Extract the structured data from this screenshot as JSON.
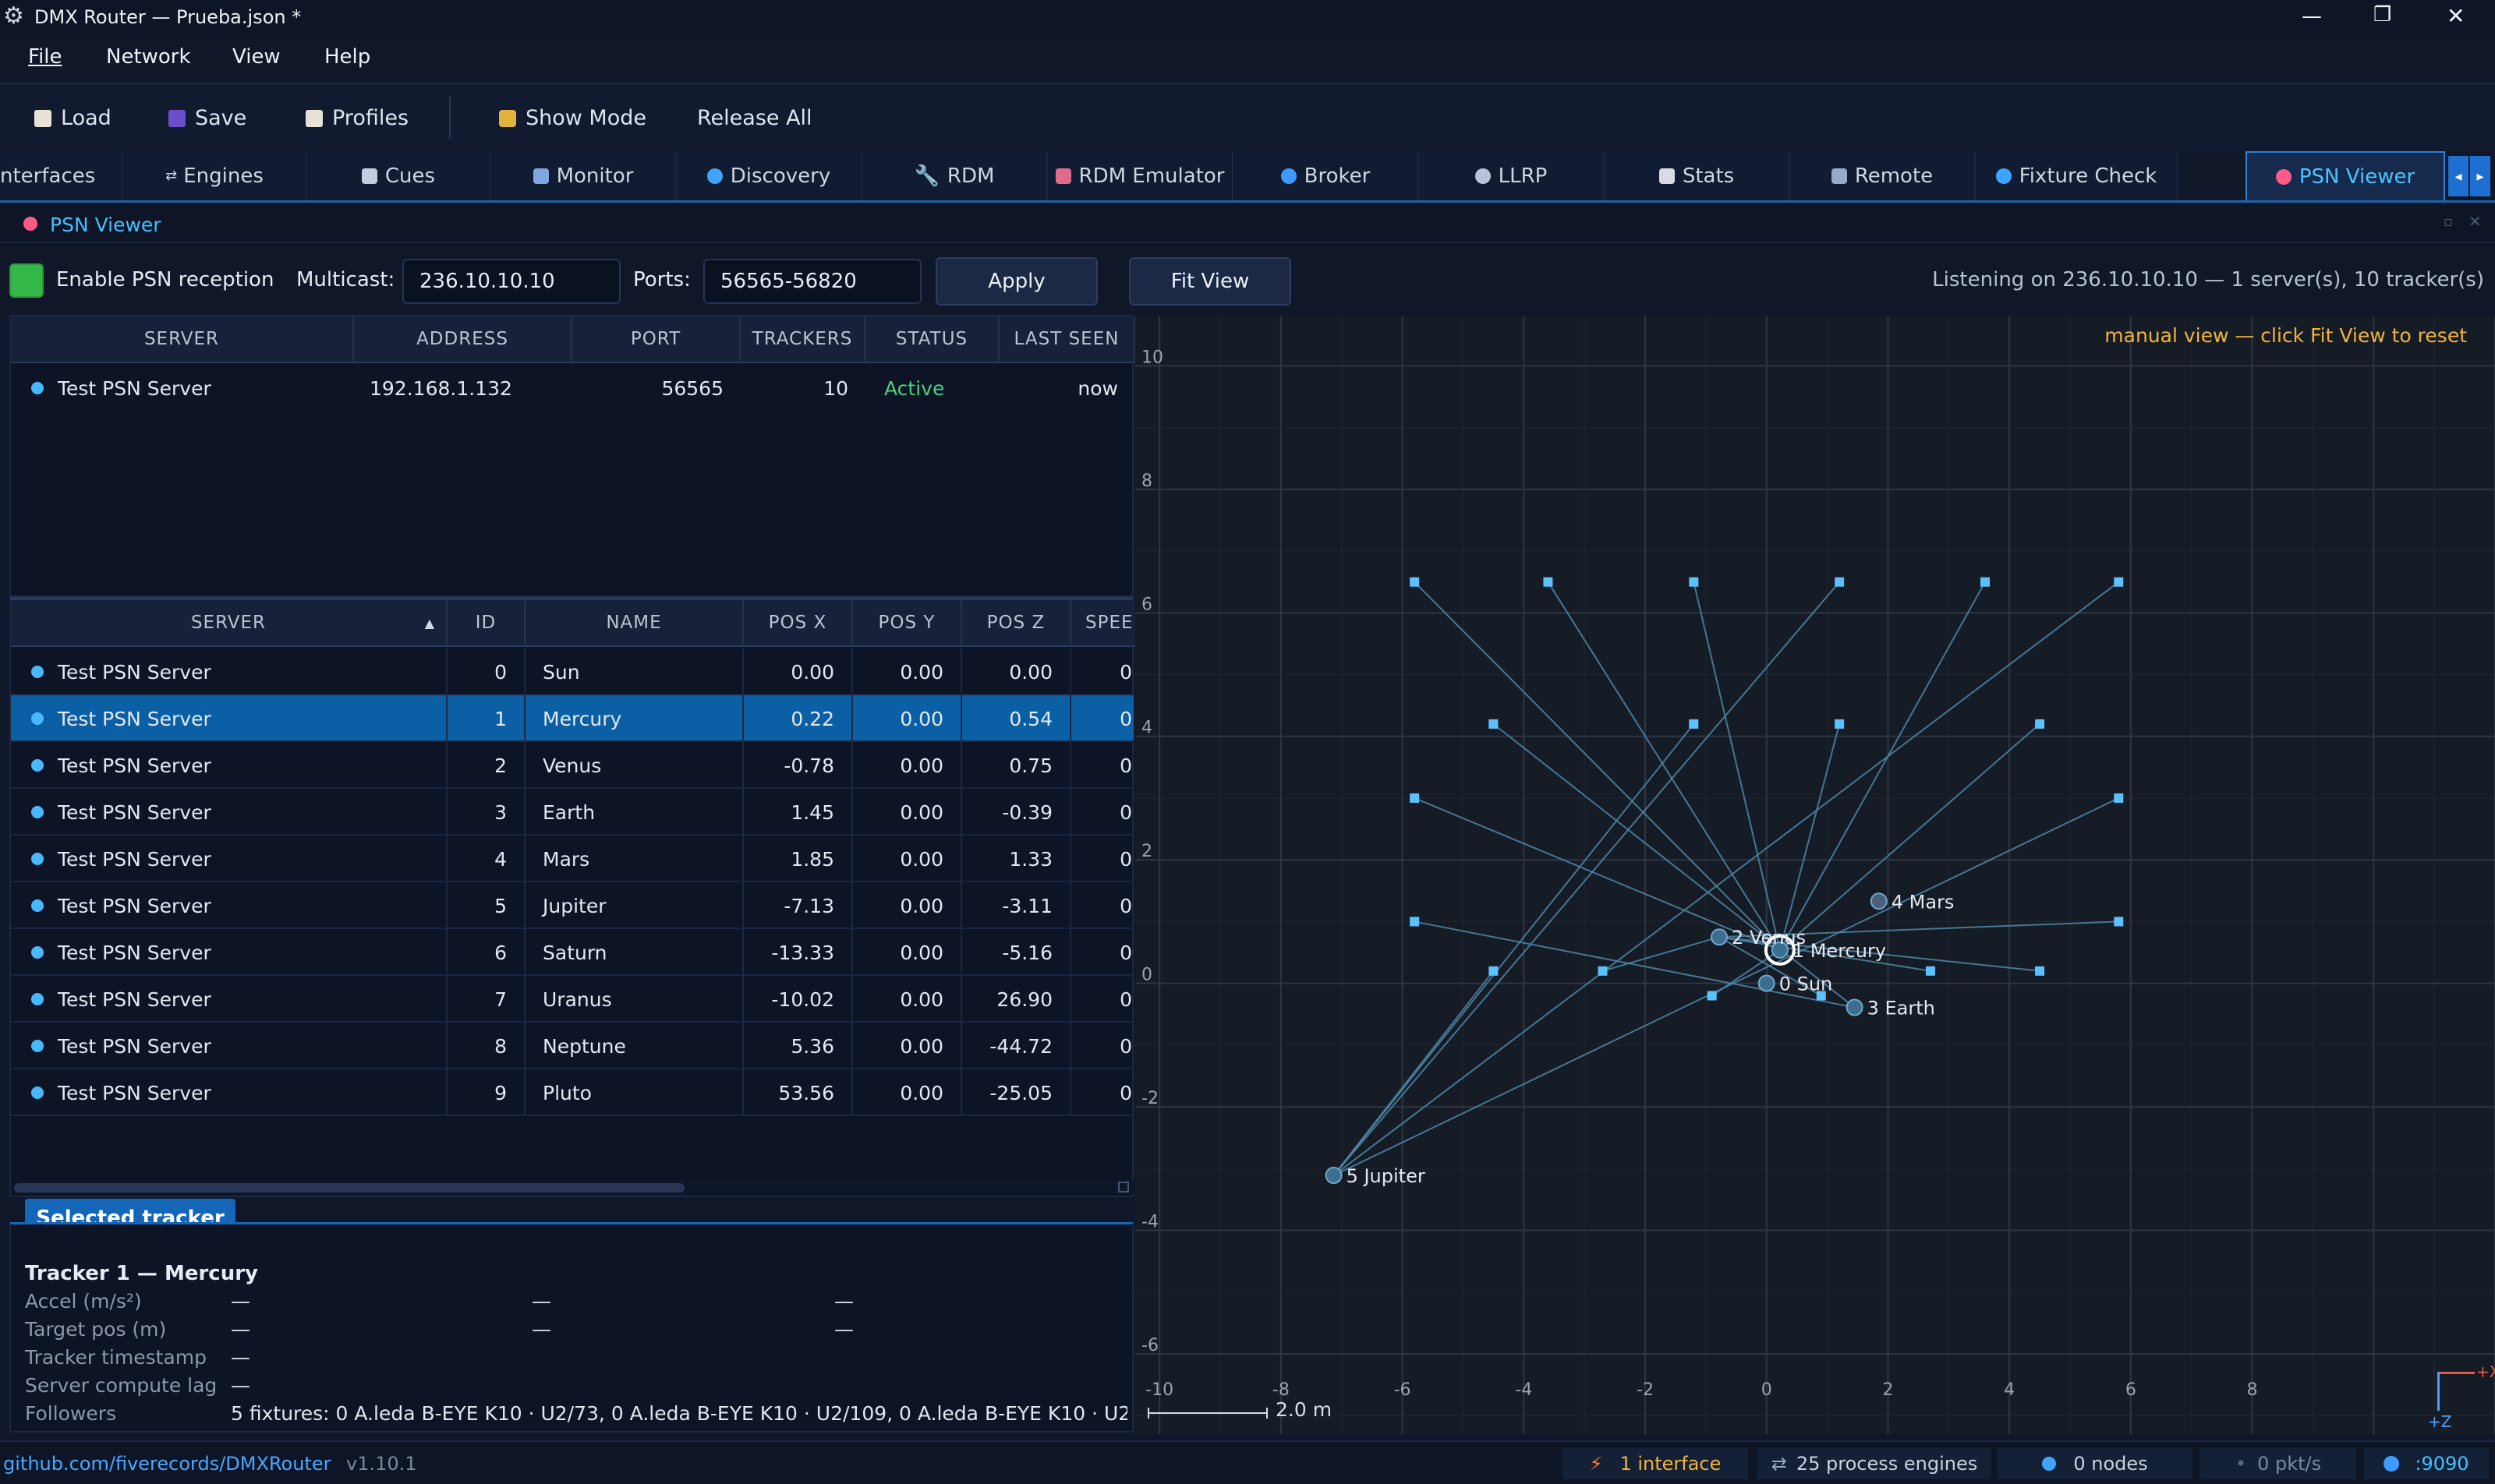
{
  "window": {
    "title": "DMX Router — Prueba.json *",
    "min": "—",
    "max": "❐",
    "close": "✕"
  },
  "menu": {
    "file": "File",
    "network": "Network",
    "view": "View",
    "help": "Help"
  },
  "toolbar": {
    "load": "Load",
    "save": "Save",
    "profiles": "Profiles",
    "show_mode": "Show Mode",
    "release_all": "Release All"
  },
  "tabs": [
    {
      "label": "nterfaces"
    },
    {
      "label": "Engines"
    },
    {
      "label": "Cues"
    },
    {
      "label": "Monitor"
    },
    {
      "label": "Discovery"
    },
    {
      "label": "RDM"
    },
    {
      "label": "RDM Emulator"
    },
    {
      "label": "Broker"
    },
    {
      "label": "LLRP"
    },
    {
      "label": "Stats"
    },
    {
      "label": "Remote"
    },
    {
      "label": "Fixture Check"
    },
    {
      "label": "PSN Viewer"
    }
  ],
  "panel_title": "PSN Viewer",
  "controls": {
    "enable_label": "Enable PSN reception",
    "multicast_label": "Multicast:",
    "multicast_value": "236.10.10.10",
    "ports_label": "Ports:",
    "ports_value": "56565-56820",
    "apply": "Apply",
    "fit_view": "Fit View",
    "listening": "Listening on 236.10.10.10 — 1 server(s), 10 tracker(s)"
  },
  "servers_table": {
    "headers": [
      "SERVER",
      "ADDRESS",
      "PORT",
      "TRACKERS",
      "STATUS",
      "LAST SEEN"
    ],
    "rows": [
      {
        "server": "Test PSN Server",
        "address": "192.168.1.132",
        "port": "56565",
        "trackers": "10",
        "status": "Active",
        "last_seen": "now"
      }
    ]
  },
  "trackers_table": {
    "headers": [
      "SERVER",
      "ID",
      "NAME",
      "POS X",
      "POS Y",
      "POS Z",
      "SPEE"
    ],
    "sort_icon": "▲",
    "rows": [
      {
        "server": "Test PSN Server",
        "id": "0",
        "name": "Sun",
        "x": "0.00",
        "y": "0.00",
        "z": "0.00",
        "s": "0"
      },
      {
        "server": "Test PSN Server",
        "id": "1",
        "name": "Mercury",
        "x": "0.22",
        "y": "0.00",
        "z": "0.54",
        "s": "0"
      },
      {
        "server": "Test PSN Server",
        "id": "2",
        "name": "Venus",
        "x": "-0.78",
        "y": "0.00",
        "z": "0.75",
        "s": "0"
      },
      {
        "server": "Test PSN Server",
        "id": "3",
        "name": "Earth",
        "x": "1.45",
        "y": "0.00",
        "z": "-0.39",
        "s": "0"
      },
      {
        "server": "Test PSN Server",
        "id": "4",
        "name": "Mars",
        "x": "1.85",
        "y": "0.00",
        "z": "1.33",
        "s": "0"
      },
      {
        "server": "Test PSN Server",
        "id": "5",
        "name": "Jupiter",
        "x": "-7.13",
        "y": "0.00",
        "z": "-3.11",
        "s": "0"
      },
      {
        "server": "Test PSN Server",
        "id": "6",
        "name": "Saturn",
        "x": "-13.33",
        "y": "0.00",
        "z": "-5.16",
        "s": "0"
      },
      {
        "server": "Test PSN Server",
        "id": "7",
        "name": "Uranus",
        "x": "-10.02",
        "y": "0.00",
        "z": "26.90",
        "s": "0"
      },
      {
        "server": "Test PSN Server",
        "id": "8",
        "name": "Neptune",
        "x": "5.36",
        "y": "0.00",
        "z": "-44.72",
        "s": "0"
      },
      {
        "server": "Test PSN Server",
        "id": "9",
        "name": "Pluto",
        "x": "53.56",
        "y": "0.00",
        "z": "-25.05",
        "s": "0"
      }
    ]
  },
  "selected": {
    "tab_label": "Selected tracker",
    "title": "Tracker 1 — Mercury",
    "accel_label": "Accel (m/s²)",
    "target_label": "Target pos (m)",
    "timestamp_label": "Tracker timestamp",
    "lag_label": "Server compute lag",
    "followers_label": "Followers",
    "dash": "—",
    "followers_value": "5 fixtures: 0 A.leda B-EYE K10 · U2/73, 0 A.leda B-EYE K10 · U2/109, 0 A.leda B-EYE K10 · U2/"
  },
  "plot": {
    "note": "manual view — click Fit View to reset",
    "scale_label": "2.0 m",
    "axis_x_label": "+X",
    "axis_z_label": "+Z",
    "x_ticks": [
      "-10",
      "-8",
      "-6",
      "-4",
      "-2",
      "0",
      "2",
      "4",
      "6",
      "8"
    ],
    "y_ticks": [
      "10",
      "8",
      "6",
      "4",
      "2",
      "0",
      "-2",
      "-4",
      "-6"
    ],
    "tracker_labels": [
      "0 Sun",
      "1 Mercury",
      "2 Venus",
      "3 Earth",
      "4 Mars",
      "5 Jupiter"
    ]
  },
  "chart_data": {
    "type": "scatter",
    "xlabel": "+X",
    "ylabel": "+Z",
    "xlim": [
      -10.4,
      12.0
    ],
    "ylim": [
      -7.3,
      10.8
    ],
    "trackers": [
      {
        "id": 0,
        "name": "Sun",
        "x": 0.0,
        "z": 0.0
      },
      {
        "id": 1,
        "name": "Mercury",
        "x": 0.22,
        "z": 0.54
      },
      {
        "id": 2,
        "name": "Venus",
        "x": -0.78,
        "z": 0.75
      },
      {
        "id": 3,
        "name": "Earth",
        "x": 1.45,
        "z": -0.39
      },
      {
        "id": 4,
        "name": "Mars",
        "x": 1.85,
        "z": 1.33
      },
      {
        "id": 5,
        "name": "Jupiter",
        "x": -7.13,
        "z": -3.11
      }
    ],
    "fixtures": [
      {
        "x": -5.8,
        "z": 6.5,
        "to": 1
      },
      {
        "x": -3.6,
        "z": 6.5,
        "to": 1
      },
      {
        "x": -1.2,
        "z": 6.5,
        "to": 1
      },
      {
        "x": 1.2,
        "z": 6.5,
        "to": 5
      },
      {
        "x": 3.6,
        "z": 6.5,
        "to": 1
      },
      {
        "x": 5.8,
        "z": 6.5,
        "to": 5
      },
      {
        "x": -4.5,
        "z": 4.2,
        "to": 3
      },
      {
        "x": -1.2,
        "z": 4.2,
        "to": 5
      },
      {
        "x": 1.2,
        "z": 4.2,
        "to": 1
      },
      {
        "x": 4.5,
        "z": 4.2,
        "to": 1
      },
      {
        "x": -5.8,
        "z": 3.0,
        "to": 1
      },
      {
        "x": 5.8,
        "z": 3.0,
        "to": 5
      },
      {
        "x": -5.8,
        "z": 1.0,
        "to": 3
      },
      {
        "x": 5.8,
        "z": 1.0,
        "to": 2
      },
      {
        "x": -4.5,
        "z": 0.2,
        "to": 5
      },
      {
        "x": -2.7,
        "z": 0.2,
        "to": 2
      },
      {
        "x": 2.7,
        "z": 0.2,
        "to": 2
      },
      {
        "x": 4.5,
        "z": 0.2,
        "to": 2
      },
      {
        "x": -0.9,
        "z": -0.2,
        "to": 1
      },
      {
        "x": 0.9,
        "z": -0.2,
        "to": 2
      }
    ]
  },
  "status": {
    "repo": "github.com/fiverecords/DMXRouter",
    "version": "v1.10.1",
    "interfaces": "1 interface",
    "engines": "25 process engines",
    "nodes": "0 nodes",
    "pkts": "0 pkt/s",
    "port": ":9090"
  },
  "colors": {
    "accent": "#45c0ff",
    "selection": "#0b5fa5",
    "active": "#4cd07a",
    "note": "#f0b43c",
    "grid": "#2c3442"
  }
}
